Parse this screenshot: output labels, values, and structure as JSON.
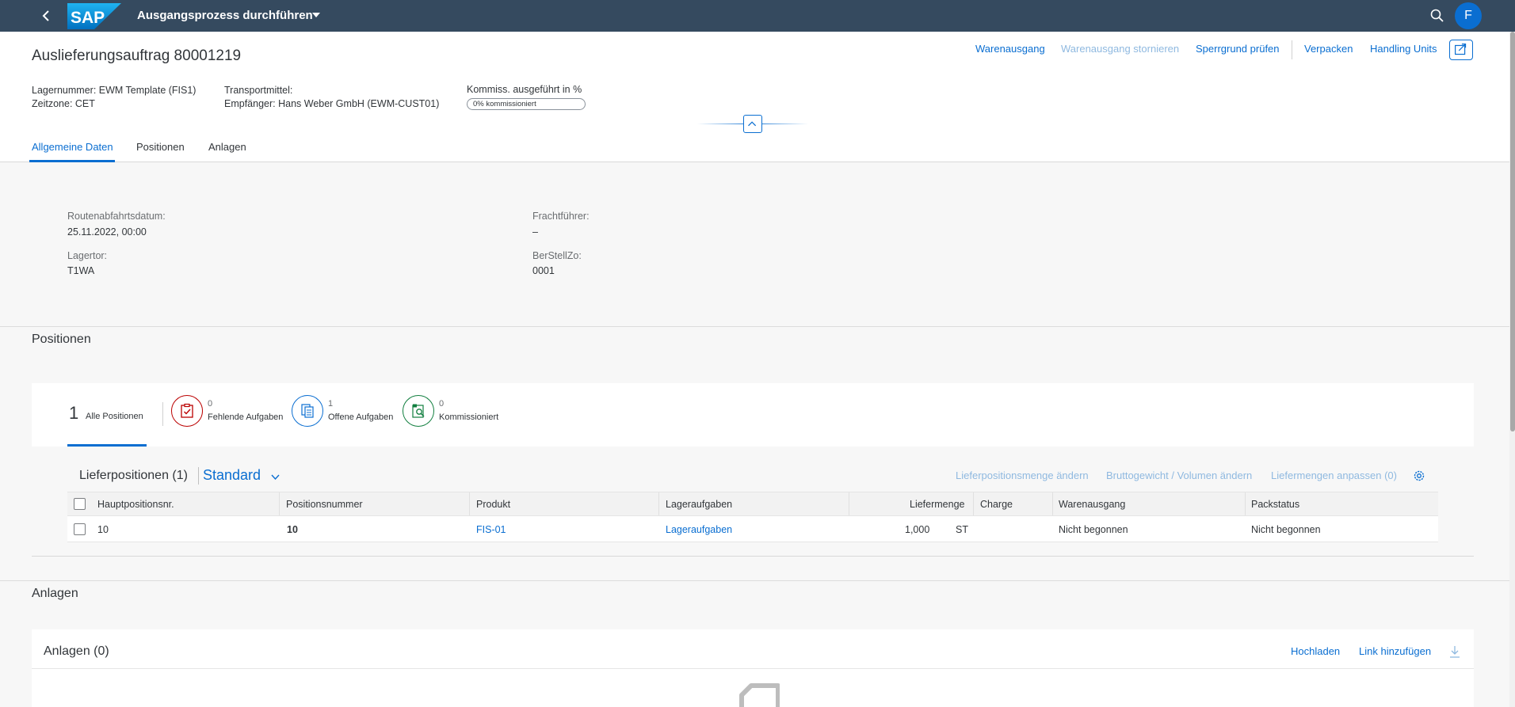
{
  "shell": {
    "app_title": "Ausgangsprozess durchführen",
    "logo_text": "SAP",
    "avatar_initial": "F"
  },
  "header": {
    "title": "Auslieferungsauftrag 80001219",
    "actions": {
      "warenausgang": "Warenausgang",
      "warenausgang_stornieren": "Warenausgang stornieren",
      "sperrgrund_pruefen": "Sperrgrund prüfen",
      "verpacken": "Verpacken",
      "handling_units": "Handling Units"
    },
    "lagernummer": "Lagernummer: EWM Template (FIS1)",
    "zeitzone": "Zeitzone: CET",
    "transportmittel": "Transportmittel:",
    "empfaenger": "Empfänger: Hans Weber GmbH (EWM-CUST01)",
    "kommiss_label": "Kommiss. ausgeführt in %",
    "kommiss_value": "0% kommissioniert",
    "kommiss_percent": 0
  },
  "tabs": [
    "Allgemeine Daten",
    "Positionen",
    "Anlagen"
  ],
  "general": {
    "routenabfahrtsdatum_label": "Routenabfahrtsdatum:",
    "routenabfahrtsdatum_value": "25.11.2022, 00:00",
    "lagertor_label": "Lagertor:",
    "lagertor_value": "T1WA",
    "frachtfuehrer_label": "Frachtführer:",
    "frachtfuehrer_value": "–",
    "berstellzo_label": "BerStellZo:",
    "berstellzo_value": "0001"
  },
  "positionen": {
    "section_title": "Positionen",
    "all_count": "1",
    "all_label": "Alle Positionen",
    "filters": [
      {
        "count": "0",
        "label": "Fehlende Aufgaben",
        "color": "#bb0000"
      },
      {
        "count": "1",
        "label": "Offene Aufgaben",
        "color": "#0a6ed1"
      },
      {
        "count": "0",
        "label": "Kommissioniert",
        "color": "#107e3e"
      }
    ],
    "table_title": "Lieferpositionen (1)",
    "variant": "Standard",
    "toolbar": {
      "menge_aendern": "Lieferpositionsmenge ändern",
      "gewicht_aendern": "Bruttogewicht / Volumen ändern",
      "mengen_anpassen": "Liefermengen anpassen (0)"
    },
    "columns": [
      "Hauptpositionsnr.",
      "Positionsnummer",
      "Produkt",
      "Lageraufgaben",
      "Liefermenge",
      "Charge",
      "Warenausgang",
      "Packstatus"
    ],
    "rows": [
      {
        "hauptposition": "10",
        "positionsnummer": "10",
        "produkt": "FIS-01",
        "lageraufgaben": "Lageraufgaben",
        "liefermenge": "1,000",
        "einheit": "ST",
        "charge": "",
        "warenausgang": "Nicht begonnen",
        "packstatus": "Nicht begonnen"
      }
    ]
  },
  "anlagen": {
    "section_title": "Anlagen",
    "card_title": "Anlagen (0)",
    "hochladen": "Hochladen",
    "link_hinzufuegen": "Link hinzufügen"
  },
  "colors": {
    "shell": "#354a5f",
    "accent": "#0a6ed1",
    "disabled_link": "#8fb9e0",
    "negative": "#bb0000",
    "positive": "#107e3e"
  }
}
